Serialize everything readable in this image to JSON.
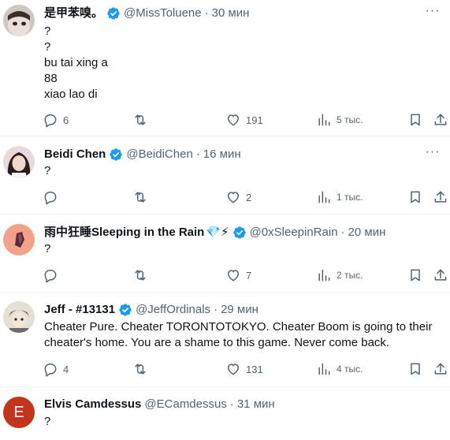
{
  "tweets": [
    {
      "name": "是甲苯嗅。",
      "handle": "@MissToluene",
      "time": "30 мин",
      "lines": [
        "?",
        "?",
        "bu tai xing a",
        "88",
        "xiao lao di"
      ],
      "replies": "6",
      "likes": "191",
      "views": "5 тыс."
    },
    {
      "name": "Beidi Chen",
      "handle": "@BeidiChen",
      "time": "16 мин",
      "lines": [
        "?"
      ],
      "replies": "",
      "likes": "2",
      "views": "1 тыс."
    },
    {
      "name": "雨中狂睡Sleeping in the Rain",
      "emoji": "💎⚡",
      "handle": "@0xSleepinRain",
      "time": "20 мин",
      "lines": [
        "?"
      ],
      "replies": "",
      "likes": "7",
      "views": "2 тыс."
    },
    {
      "name": "Jeff - #13131",
      "handle": "@JeffOrdinals",
      "time": "29 мин",
      "lines": [
        "Cheater Pure. Cheater TORONTOTOKYO. Cheater Boom is going to their",
        "cheater's home.  You are a shame to this game. Never come back."
      ],
      "replies": "4",
      "likes": "131",
      "views": "4 тыс."
    },
    {
      "name": "Elvis Camdessus",
      "handle": "@ECamdessus",
      "time": "31 мин",
      "lines": [
        "?"
      ],
      "avatar_letter": "E"
    }
  ],
  "separator": "·",
  "colors": {
    "verified": "#1d9bf0",
    "secondary_text": "#536471",
    "primary_text": "#0f1419",
    "avatar_e": "#c1351d"
  },
  "icons": [
    "verified-badge-icon",
    "more-icon",
    "reply-icon",
    "retweet-icon",
    "like-icon",
    "views-icon",
    "bookmark-icon",
    "share-icon"
  ]
}
